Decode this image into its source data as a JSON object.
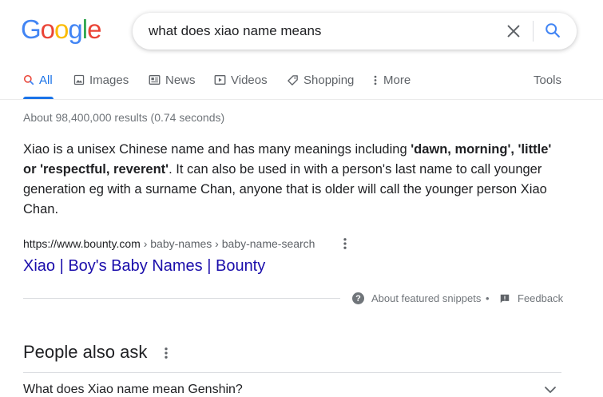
{
  "logo": {
    "letters": [
      "G",
      "o",
      "o",
      "g",
      "l",
      "e"
    ],
    "colors": [
      "#4285F4",
      "#EA4335",
      "#FBBC05",
      "#4285F4",
      "#34A853",
      "#EA4335"
    ]
  },
  "search": {
    "query": "what does xiao name means"
  },
  "tabs": [
    {
      "label": "All",
      "icon": "search-icon",
      "active": true
    },
    {
      "label": "Images",
      "icon": "image-icon"
    },
    {
      "label": "News",
      "icon": "news-icon"
    },
    {
      "label": "Videos",
      "icon": "video-icon"
    },
    {
      "label": "Shopping",
      "icon": "tag-icon"
    },
    {
      "label": "More",
      "icon": "more-vert-icon"
    }
  ],
  "tools_label": "Tools",
  "result_stats": "About 98,400,000 results (0.74 seconds)",
  "featured_snippet": {
    "text_1": "Xiao is a unisex Chinese name and has many meanings including ",
    "bold_1": "'dawn, morning', 'little' or 'respectful, reverent'",
    "text_2": ". It can also be used in with a person's last name to call younger generation eg with a surname Chan, anyone that is older will call the younger person Xiao Chan."
  },
  "source": {
    "domain": "https://www.bounty.com",
    "breadcrumbs": " › baby-names › baby-name-search",
    "title": "Xiao | Boy's Baby Names | Bounty"
  },
  "snippet_footer": {
    "about_label": "About featured snippets",
    "separator": "•",
    "feedback_label": "Feedback"
  },
  "people_also_ask": {
    "title": "People also ask",
    "questions": [
      "What does Xiao name mean Genshin?"
    ]
  },
  "colors": {
    "accent": "#1a73e8",
    "link": "#1a0dab",
    "muted": "#70757a"
  }
}
